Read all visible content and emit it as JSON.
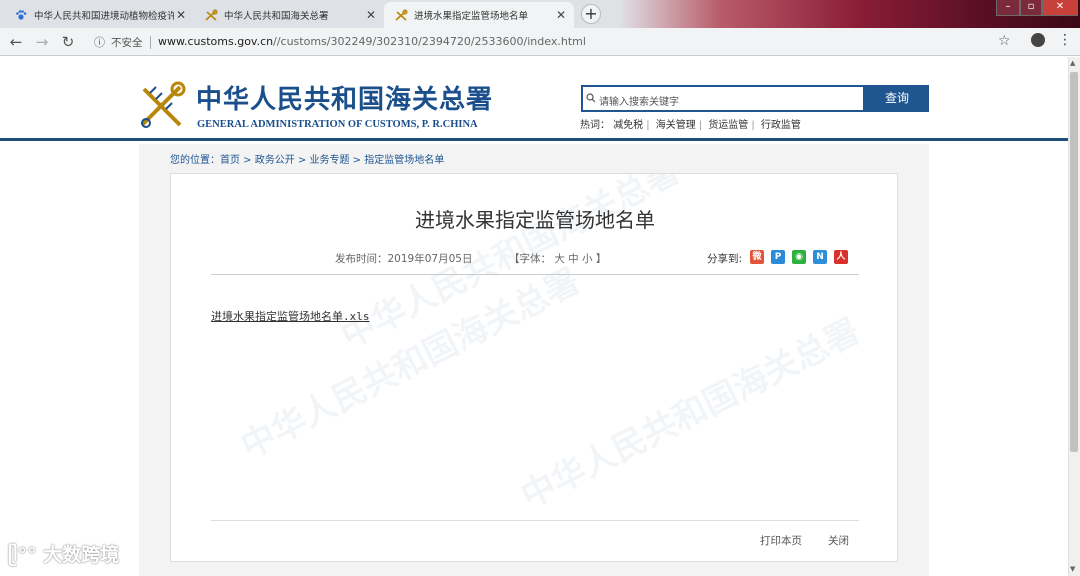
{
  "browser": {
    "tabs": [
      {
        "label": "中华人民共和国进境动植物检疫许",
        "icon": "paw-icon",
        "active": false
      },
      {
        "label": "中华人民共和国海关总署",
        "icon": "customs-icon",
        "active": false
      },
      {
        "label": "进境水果指定监管场地名单",
        "icon": "customs-icon",
        "active": true
      }
    ],
    "new_tab": "+",
    "security": "不安全",
    "url_host": "www.customs.gov.cn",
    "url_path": "//customs/302249/302310/2394720/2533600/index.html"
  },
  "header": {
    "title_cn": "中华人民共和国海关总署",
    "title_en": "GENERAL ADMINISTRATION OF CUSTOMS, P. R.CHINA",
    "search_placeholder": "请输入搜索关键字",
    "search_button": "查询",
    "hot_label": "热词：",
    "hot_terms": [
      "减免税",
      "海关管理",
      "货运监管",
      "行政监管"
    ]
  },
  "breadcrumb": {
    "prefix": "您的位置：",
    "items": [
      "首页",
      "政务公开",
      "业务专题",
      "指定监管场地名单"
    ],
    "sep": " > "
  },
  "article": {
    "title": "进境水果指定监管场地名单",
    "date": "发布时间：2019年07月05日",
    "font_size_label": "【字体： 大 中 小 】",
    "share_label": "分享到:",
    "share_icons": [
      "weibo-icon",
      "tencent-icon",
      "wechat-icon",
      "renren-icon",
      "pdf-icon"
    ],
    "attachment": "进境水果指定监管场地名单.xls",
    "print": "打印本页",
    "close": "关闭",
    "watermark_cn": "中华人民共和国海关总署"
  },
  "corner_watermark": "大数跨境",
  "colors": {
    "brand": "#1a4f8b",
    "search": "#1f5690"
  }
}
